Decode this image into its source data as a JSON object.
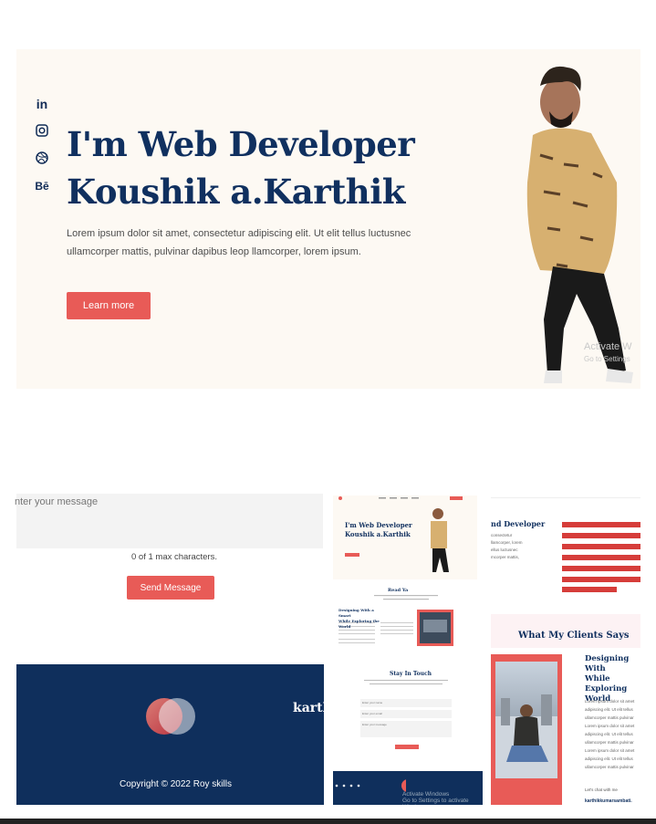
{
  "hero": {
    "title_line1": "I'm Web Developer",
    "title_line2": "Koushik a.Karthik",
    "description": "Lorem ipsum dolor sit amet, consectetur adipiscing elit. Ut elit tellus luctusnec ullamcorper mattis, pulvinar dapibus leop llamcorper, lorem ipsum.",
    "button": "Learn more",
    "watermark": "Activate W\nGo to Settings",
    "social": [
      "in",
      "◎",
      "⊛",
      "Bē"
    ]
  },
  "contact": {
    "placeholder": "nter your message",
    "chars": "0 of 1 max characters.",
    "send": "Send Message"
  },
  "footer": {
    "brand": "karth",
    "copyright": "Copyright © 2022 Roy skills"
  },
  "thumb1": {
    "title": "I'm Web Developer\nKoushik a.Karthik"
  },
  "thumb2": {
    "title": "Read Ya",
    "sub": "Designing With a Smart\nWhile Exploring the World"
  },
  "thumb3": {
    "title": "Stay In Touch",
    "fields": [
      "Enter your name",
      "Enter your email",
      "Enter your message"
    ],
    "watermark": "Activate Windows\nGo to Settings to activate Windows."
  },
  "thumb4": {
    "title": "nd Developer",
    "text": "consectetur\nllamcorper, lorem\nellus luctusnec\nmcorper mattis,",
    "bars": [
      "",
      "",
      "",
      "",
      "",
      "",
      ""
    ],
    "clients": "What My Clients Says"
  },
  "thumb5": {
    "heading": "Designing With\nWhile Exploring\nWorld",
    "para": "Lorem ipsum dolor sit amet adipiscing elit. Ut elit tellus ullamcorper mattis pulvinar Lorem ipsum dolor sit amet adipiscing elit. Ut elit tellus ullamcorper mattis pulvinar Lorem ipsum dolor sit amet adipiscing elit. Ut elit tellus ullamcorper mattis pulvinar",
    "chat": "Let's chat with me",
    "email": "karthikkumarsambati."
  },
  "colors": {
    "navy": "#10305f",
    "accent": "#e85b57",
    "cream": "#fdf9f3"
  }
}
